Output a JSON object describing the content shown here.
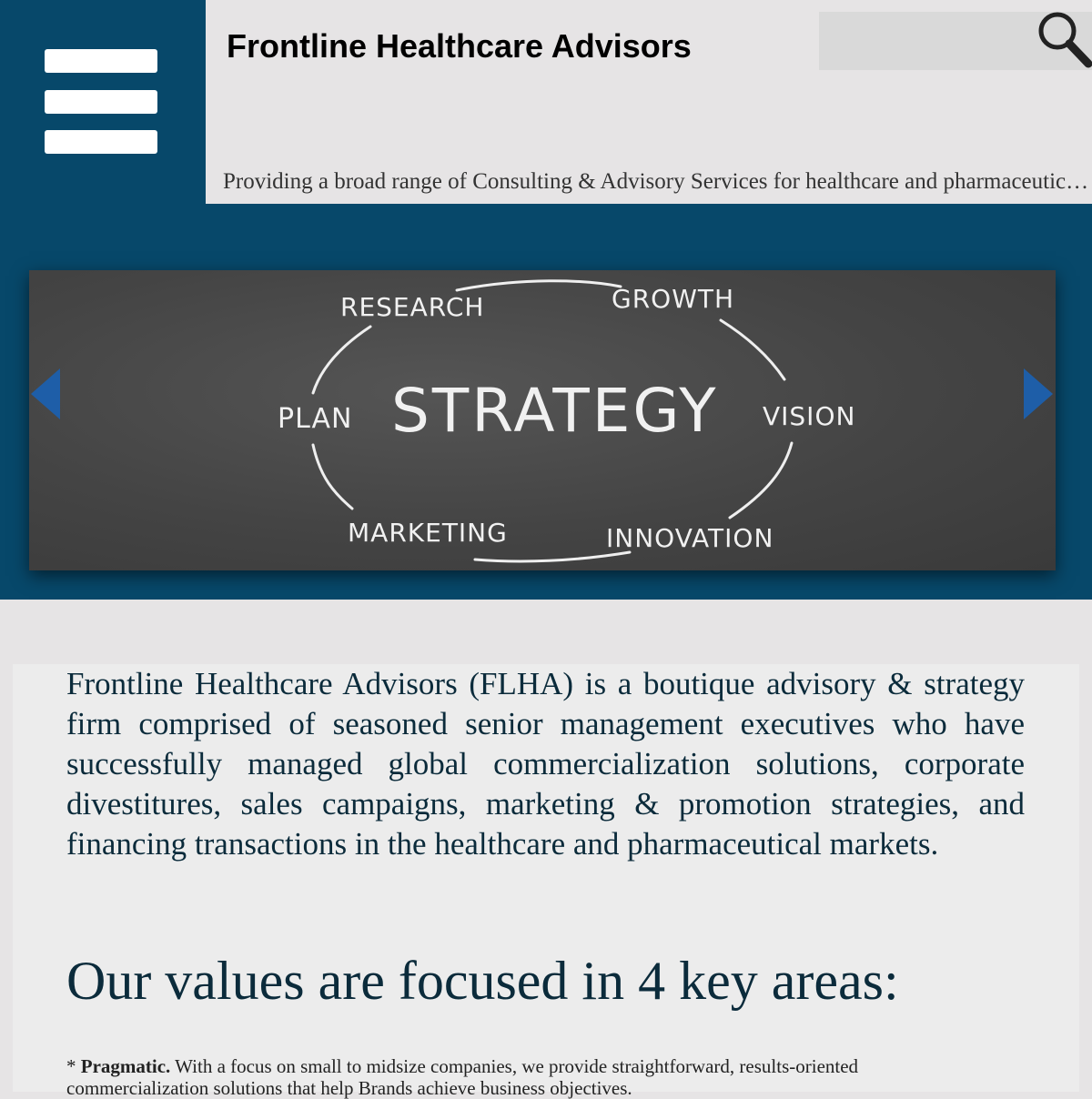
{
  "header": {
    "title": "Frontline Healthcare Advisors",
    "tagline": "Providing a broad range of Consulting & Advisory Services for healthcare and pharmaceutical markets",
    "search_placeholder": "",
    "menu_icon": "hamburger-icon",
    "search_icon": "magnifier-icon"
  },
  "slider": {
    "words": {
      "center": "STRATEGY",
      "research": "RESEARCH",
      "growth": "GROWTH",
      "plan": "PLAN",
      "vision": "VISION",
      "marketing": "MARKETING",
      "innovation": "INNOVATION"
    },
    "prev_icon": "triangle-left-icon",
    "next_icon": "triangle-right-icon"
  },
  "content": {
    "intro": "Frontline Healthcare Advisors (FLHA) is a boutique advisory & strategy firm comprised of seasoned senior management executives who have successfully managed global commercialization solutions, corporate divestitures, sales campaigns, marketing & promotion strategies, and financing transactions in the healthcare and pharmaceutical markets.",
    "values_heading": "Our values are focused in 4 key areas:",
    "values": [
      {
        "prefix": "* ",
        "term": "Pragmatic.",
        "text": " With a focus on small to midsize companies, we provide straightforward, results-oriented commercialization solutions that help Brands achieve business objectives."
      }
    ]
  },
  "colors": {
    "brand_blue": "#07486a",
    "arrow_blue": "#1e5ea8",
    "text_dark": "#0b2b3b",
    "panel_gray": "#e6e4e5"
  }
}
